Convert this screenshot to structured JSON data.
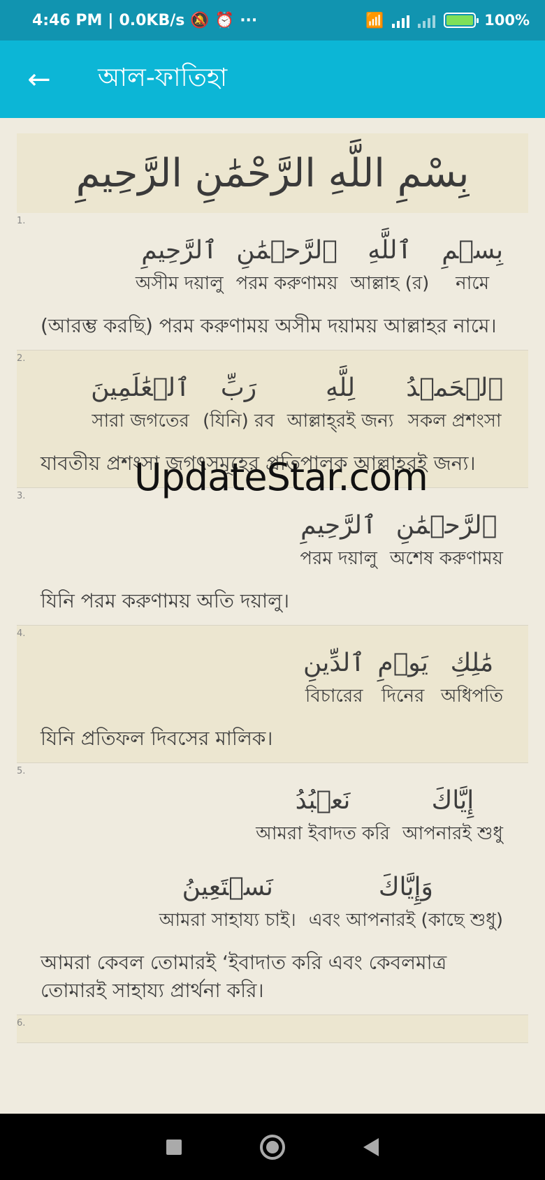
{
  "status_bar": {
    "time": "4:46 PM",
    "net_speed": "0.0KB/s",
    "dots": "···",
    "battery": "100"
  },
  "app_bar": {
    "title": "আল-ফাতিহা"
  },
  "bismillah": "بِسْمِ اللَّهِ الرَّحْمَٰنِ الرَّحِيمِ",
  "ayahs": [
    {
      "number": "1.",
      "rows": [
        [
          {
            "ar": "بِسۡمِ",
            "bn": "নামে"
          },
          {
            "ar": "ٱللَّهِ",
            "bn": "আল্লাহ (র)"
          },
          {
            "ar": "ٱلرَّحۡمَٰنِ",
            "bn": "পরম করুণাময়"
          },
          {
            "ar": "ٱلرَّحِيمِ",
            "bn": "অসীম দয়ালু"
          }
        ]
      ],
      "translation": "(আরম্ভ করছি) পরম করুণাময় অসীম দয়াময় আল্লাহর নামে।"
    },
    {
      "number": "2.",
      "rows": [
        [
          {
            "ar": "ٱلۡحَمۡدُ",
            "bn": "সকল প্রশংসা"
          },
          {
            "ar": "لِلَّهِ",
            "bn": "আল্লাহ্‌রই জন্য"
          },
          {
            "ar": "رَبِّ",
            "bn": "(যিনি) রব"
          },
          {
            "ar": "ٱلۡعَٰلَمِينَ",
            "bn": "সারা জগতের"
          }
        ]
      ],
      "translation": "যাবতীয় প্রশংসা জগৎসমূহের প্রতিপালক আল্লাহরই জন্য।"
    },
    {
      "number": "3.",
      "rows": [
        [
          {
            "ar": "ٱلرَّحۡمَٰنِ",
            "bn": "অশেষ করুণাময়"
          },
          {
            "ar": "ٱلرَّحِيمِ",
            "bn": "পরম দয়ালু"
          }
        ]
      ],
      "translation": "যিনি পরম করুণাময় অতি দয়ালু।"
    },
    {
      "number": "4.",
      "rows": [
        [
          {
            "ar": "مَٰلِكِ",
            "bn": "অধিপতি"
          },
          {
            "ar": "يَوۡمِ",
            "bn": "দিনের"
          },
          {
            "ar": "ٱلدِّينِ",
            "bn": "বিচারের"
          }
        ]
      ],
      "translation": "যিনি প্রতিফল দিবসের মালিক।"
    },
    {
      "number": "5.",
      "rows": [
        [
          {
            "ar": "إِيَّاكَ",
            "bn": "আপনারই শুধু"
          },
          {
            "ar": "نَعۡبُدُ",
            "bn": "আমরা ইবাদত করি"
          }
        ],
        [
          {
            "ar": "وَإِيَّاكَ",
            "bn": "এবং আপনারই (কাছে  শুধু)"
          },
          {
            "ar": "نَسۡتَعِينُ",
            "bn": "আমরা সাহায্য চাই।"
          }
        ]
      ],
      "translation": "আমরা কেবল তোমারই ‘ইবাদাত করি এবং কেবলমাত্র তোমারই সাহায্য প্রার্থনা করি।"
    },
    {
      "number": "6.",
      "rows": [],
      "translation": ""
    }
  ],
  "watermark": "UpdateStar.com"
}
